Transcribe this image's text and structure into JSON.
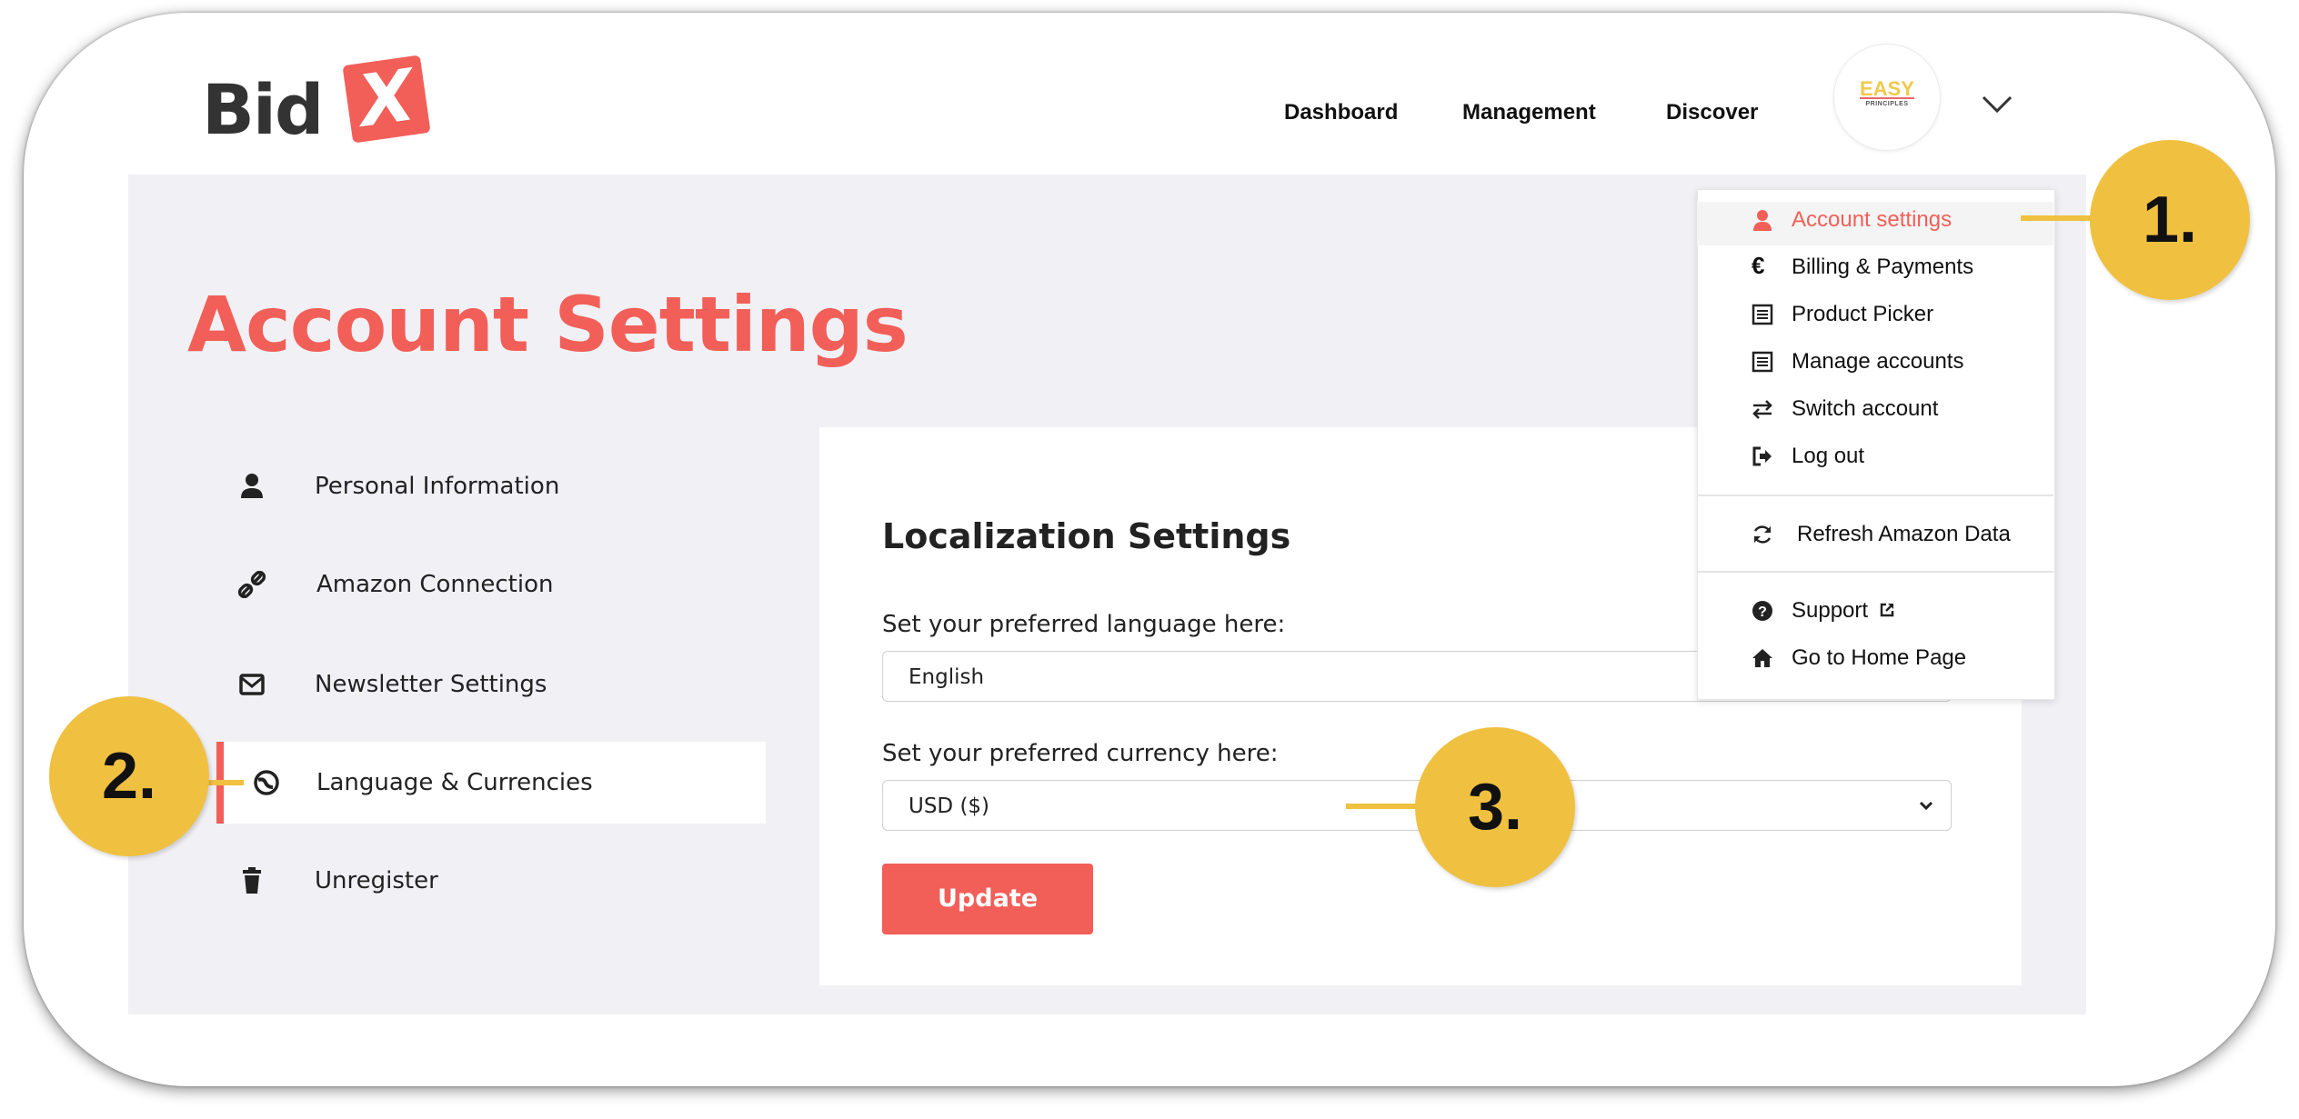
{
  "header": {
    "logo_text": "Bid",
    "logo_mark": "X",
    "nav": [
      "Dashboard",
      "Management",
      "Discover"
    ],
    "avatar_line1": "EASY",
    "avatar_line2": "PRINCIPLES",
    "menu_toggle_icon": "chevron-down-icon"
  },
  "page": {
    "title": "Account Settings"
  },
  "sidebar": {
    "items": [
      {
        "label": "Personal Information",
        "icon": "user-icon"
      },
      {
        "label": "Amazon Connection",
        "icon": "link-icon"
      },
      {
        "label": "Newsletter Settings",
        "icon": "mail-icon"
      },
      {
        "label": "Language & Currencies",
        "icon": "globe-icon",
        "active": true
      },
      {
        "label": "Unregister",
        "icon": "trash-icon"
      }
    ]
  },
  "localization": {
    "title": "Localization Settings",
    "language_label": "Set your preferred language here:",
    "language_value": "English",
    "currency_label": "Set your preferred currency here:",
    "currency_value": "USD ($)",
    "update_label": "Update"
  },
  "dropdown": {
    "items": [
      {
        "label": "Account settings",
        "icon": "user-icon",
        "active": true
      },
      {
        "label": "Billing & Payments",
        "icon": "euro-icon"
      },
      {
        "label": "Product Picker",
        "icon": "list-icon"
      },
      {
        "label": "Manage accounts",
        "icon": "list-icon"
      },
      {
        "label": "Switch account",
        "icon": "swap-icon"
      },
      {
        "label": "Log out",
        "icon": "logout-icon"
      },
      {
        "label": "Refresh Amazon Data",
        "icon": "refresh-icon"
      },
      {
        "label": "Support",
        "icon": "help-icon"
      },
      {
        "label": "Go to Home Page",
        "icon": "home-icon"
      }
    ]
  },
  "annotations": {
    "step1": "1.",
    "step2": "2.",
    "step3": "3."
  },
  "colors": {
    "accent": "#f25f58",
    "annotation": "#f0c040",
    "panel": "#f1f0f5"
  }
}
